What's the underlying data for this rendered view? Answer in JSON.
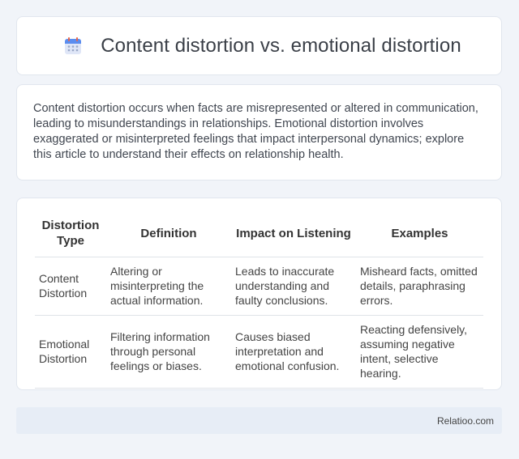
{
  "header": {
    "title": "Content distortion vs. emotional distortion",
    "icon": "calendar-icon"
  },
  "intro": {
    "text": "Content distortion occurs when facts are misrepresented or altered in communication, leading to misunderstandings in relationships. Emotional distortion involves exaggerated or misinterpreted feelings that impact interpersonal dynamics; explore this article to understand their effects on relationship health."
  },
  "table": {
    "headers": [
      "Distortion Type",
      "Definition",
      "Impact on Listening",
      "Examples"
    ],
    "rows": [
      [
        "Content Distortion",
        "Altering or misinterpreting the actual information.",
        "Leads to inaccurate understanding and faulty conclusions.",
        "Misheard facts, omitted details, paraphrasing errors."
      ],
      [
        "Emotional Distortion",
        "Filtering information through personal feelings or biases.",
        "Causes biased interpretation and emotional confusion.",
        "Reacting defensively, assuming negative intent, selective hearing."
      ]
    ]
  },
  "footer": {
    "brand": "Relatioo.com"
  },
  "colors": {
    "background": "#f1f4f9",
    "card": "#ffffff",
    "footer": "#e7edf6"
  }
}
